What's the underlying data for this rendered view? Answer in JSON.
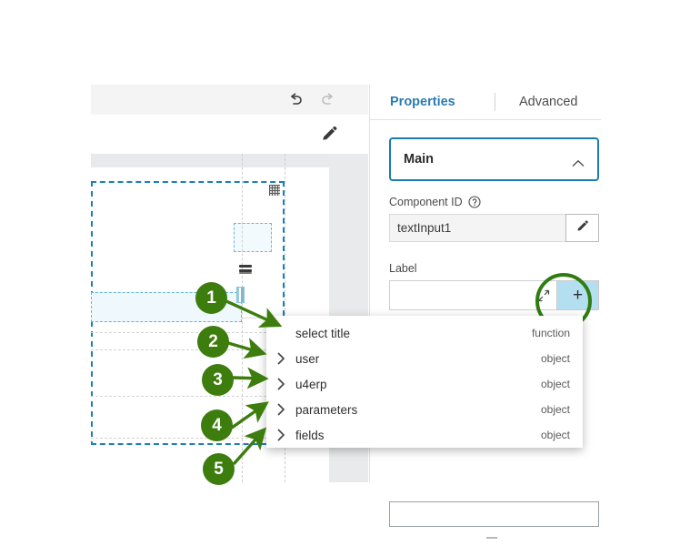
{
  "canvas": {
    "toolbar": {
      "undo_icon": "undo-icon",
      "redo_icon": "redo-icon"
    },
    "edit_icon": "pencil-icon",
    "resize_grip_icon": "resize-grip-icon",
    "layers_icon": "layers-handle-icon",
    "text_cursor_icon": "text-cursor-icon"
  },
  "properties_panel": {
    "tabs": [
      {
        "label": "Properties",
        "active": true
      },
      {
        "label": "Advanced",
        "active": false
      }
    ],
    "section": {
      "title": "Main",
      "collapse_icon": "chevron-up-icon"
    },
    "fields": [
      {
        "label": "Component ID",
        "help_icon": "help-circle-icon",
        "value": "textInput1",
        "readonly": true,
        "action_icon": "pencil-icon"
      },
      {
        "label": "Label",
        "value": "",
        "placeholder": "",
        "expand_icon": "expand-arrows-icon",
        "add_button_label": "+"
      }
    ]
  },
  "dropdown": {
    "items": [
      {
        "name": "select title",
        "type": "function",
        "expandable": false
      },
      {
        "name": "user",
        "type": "object",
        "expandable": true
      },
      {
        "name": "u4erp",
        "type": "object",
        "expandable": true
      },
      {
        "name": "parameters",
        "type": "object",
        "expandable": true
      },
      {
        "name": "fields",
        "type": "object",
        "expandable": true
      }
    ],
    "chevron_icon": "chevron-right-icon"
  },
  "annotations": {
    "badges": [
      {
        "number": "1"
      },
      {
        "number": "2"
      },
      {
        "number": "3"
      },
      {
        "number": "4"
      },
      {
        "number": "5"
      }
    ],
    "highlight_ring": "green-circle-highlight"
  },
  "colors": {
    "accent_blue": "#1a7cb0",
    "tab_active": "#2a7cb4",
    "annotation_green": "#3d7d0d",
    "plus_button_bg": "#b4dff0",
    "selection_dashed": "#1a7fb5"
  }
}
